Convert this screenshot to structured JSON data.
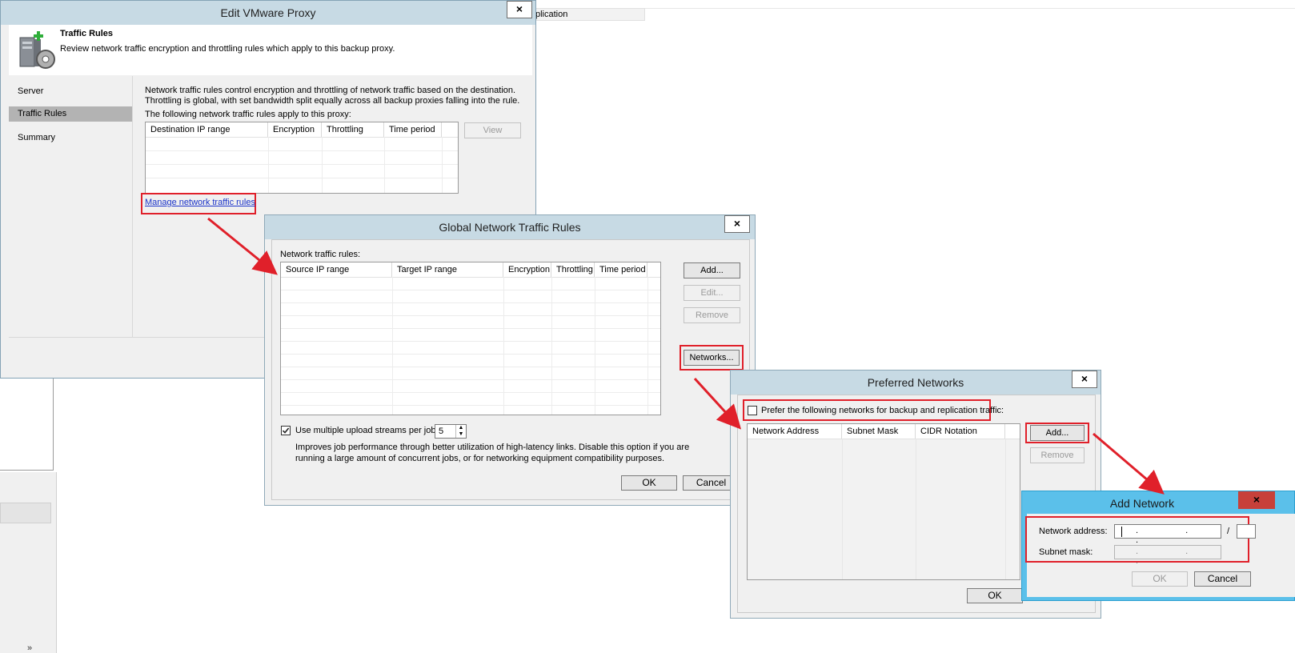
{
  "background": {
    "top_cell_text": "plication"
  },
  "edit_proxy": {
    "title": "Edit VMware Proxy",
    "close": "×",
    "header_title": "Traffic Rules",
    "header_desc": "Review network traffic encryption and throttling rules which apply to this backup proxy.",
    "nav": [
      "Server",
      "Traffic Rules",
      "Summary"
    ],
    "desc_line1": "Network traffic rules control encryption and throttling of network traffic based on the destination.",
    "desc_line2": "Throttling is global, with set bandwidth split equally across all backup proxies falling into the rule.",
    "desc_line3": "The following network traffic rules apply to this proxy:",
    "columns": [
      "Destination IP range",
      "Encryption",
      "Throttling",
      "Time period"
    ],
    "view_button": "View",
    "manage_link": "Manage network traffic rules"
  },
  "global_rules": {
    "title": "Global Network Traffic Rules",
    "close": "×",
    "rules_label": "Network traffic rules:",
    "columns": [
      "Source IP range",
      "Target IP range",
      "Encryption",
      "Throttling",
      "Time period"
    ],
    "add_button": "Add...",
    "edit_button": "Edit...",
    "remove_button": "Remove",
    "networks_button": "Networks...",
    "streams_checked": true,
    "streams_label": "Use multiple upload streams per job:",
    "streams_value": "5",
    "streams_desc1": "Improves job performance through better utilization of high-latency links. Disable this option if you are",
    "streams_desc2": "running a large amount of concurrent jobs, or for networking equipment compatibility purposes.",
    "ok_button": "OK",
    "cancel_button": "Cancel"
  },
  "preferred": {
    "title": "Preferred Networks",
    "close": "×",
    "prefer_checked": false,
    "prefer_label": "Prefer the following networks for backup and replication traffic:",
    "columns": [
      "Network Address",
      "Subnet Mask",
      "CIDR Notation"
    ],
    "add_button": "Add...",
    "remove_button": "Remove",
    "ok_button": "OK"
  },
  "add_network": {
    "title": "Add Network",
    "close": "×",
    "address_label": "Network  address:",
    "address_value": ". . .",
    "slash": "/",
    "mask_label": "Subnet mask:",
    "mask_value": ". . .",
    "ok_button": "OK",
    "cancel_button": "Cancel"
  },
  "colors": {
    "highlight_red": "#e0202a",
    "titlebar": "#c7dae4",
    "active_titlebar": "#5bc0ea"
  }
}
